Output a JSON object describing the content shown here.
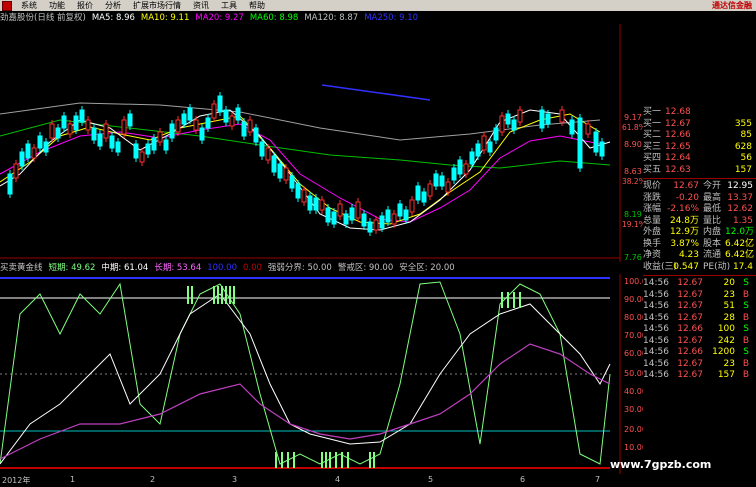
{
  "menu": {
    "items": [
      "系统",
      "功能",
      "报价",
      "分析",
      "扩展市场行情",
      "资讯",
      "工具",
      "帮助"
    ],
    "brand": "通达信金融"
  },
  "ma_line": {
    "stock": "劲嘉股份(日线 前复权)",
    "ma5": "MA5: 8.96",
    "ma10": "MA10: 9.11",
    "ma20": "MA20: 9.27",
    "ma60": "MA60: 8.98",
    "ma120": "MA120: 8.87",
    "ma250": "MA250: 9.10",
    "colors": {
      "ma5": "#ffffff",
      "ma10": "#ffff00",
      "ma20": "#ff00ff",
      "ma60": "#00ff00",
      "ma120": "#c0c0c0",
      "ma250": "#0000ff"
    }
  },
  "price_axis": [
    "9.17",
    "8.90",
    "8.63",
    "8.19",
    "7.76"
  ],
  "pct_axis": [
    "61.8%",
    "38.2%",
    "19.1%"
  ],
  "indicator_line": {
    "name": "买卖黄金线",
    "short": "短期: 49.62",
    "mid": "中期: 61.04",
    "long": "长期: 53.64",
    "zero": "100.00",
    "zero2": "0.00",
    "strong": "强弱分界: 50.00",
    "warn": "警戒区: 90.00",
    "safe": "安全区: 20.00"
  },
  "ind_axis": [
    "100.00",
    "90.00",
    "80.00",
    "70.00",
    "60.00",
    "50.00",
    "40.00",
    "30.00",
    "20.00",
    "10.00"
  ],
  "orderbook": [
    {
      "label": "买一",
      "price": "12.68",
      "vol": ""
    },
    {
      "label": "买一",
      "price": "12.67",
      "vol": "355"
    },
    {
      "label": "买二",
      "price": "12.66",
      "vol": "85"
    },
    {
      "label": "买三",
      "price": "12.65",
      "vol": "628"
    },
    {
      "label": "买四",
      "price": "12.64",
      "vol": "56"
    },
    {
      "label": "买五",
      "price": "12.63",
      "vol": "157"
    }
  ],
  "quote": [
    {
      "k": "现价",
      "v": "12.67",
      "k2": "今开",
      "v2": "12.95",
      "c": "#ff5050",
      "c2": "#ffffff"
    },
    {
      "k": "涨跌",
      "v": "-0.20",
      "k2": "最高",
      "v2": "13.37",
      "c": "#ff5050",
      "c2": "#ff5050"
    },
    {
      "k": "涨幅",
      "v": "-2.16%",
      "k2": "最低",
      "v2": "12.62",
      "c": "#ff5050",
      "c2": "#ff5050"
    },
    {
      "k": "总量",
      "v": "24.8万",
      "k2": "量比",
      "v2": "1.35",
      "c": "#ffff00",
      "c2": "#ff5050"
    },
    {
      "k": "外盘",
      "v": "12.9万",
      "k2": "内盘",
      "v2": "12.0万",
      "c": "#ffff00",
      "c2": "#00ff00"
    },
    {
      "k": "换手",
      "v": "3.87%",
      "k2": "股本",
      "v2": "6.42亿",
      "c": "#ffff00",
      "c2": "#ffff00"
    },
    {
      "k": "净资",
      "v": "4.23",
      "k2": "流通",
      "v2": "6.42亿",
      "c": "#ffff00",
      "c2": "#ffff00"
    },
    {
      "k": "收益(三)",
      "v": "0.547",
      "k2": "PE(动)",
      "v2": "17.4",
      "c": "#ffff00",
      "c2": "#ffff00"
    }
  ],
  "ticks": [
    {
      "t": "14:56",
      "p": "12.67",
      "v": "20",
      "d": "S"
    },
    {
      "t": "14:56",
      "p": "12.67",
      "v": "23",
      "d": "B"
    },
    {
      "t": "14:56",
      "p": "12.67",
      "v": "51",
      "d": "S"
    },
    {
      "t": "14:56",
      "p": "12.67",
      "v": "28",
      "d": "B"
    },
    {
      "t": "14:56",
      "p": "12.66",
      "v": "100",
      "d": "S"
    },
    {
      "t": "14:56",
      "p": "12.67",
      "v": "242",
      "d": "B"
    },
    {
      "t": "14:56",
      "p": "12.66",
      "v": "1200",
      "d": "S"
    },
    {
      "t": "14:56",
      "p": "12.67",
      "v": "23",
      "d": "B"
    },
    {
      "t": "14:56",
      "p": "12.67",
      "v": "157",
      "d": "B"
    }
  ],
  "xaxis": [
    "2012年",
    "1",
    "2",
    "3",
    "4",
    "5",
    "6",
    "7"
  ],
  "watermark": "www.7gpzb.com"
}
